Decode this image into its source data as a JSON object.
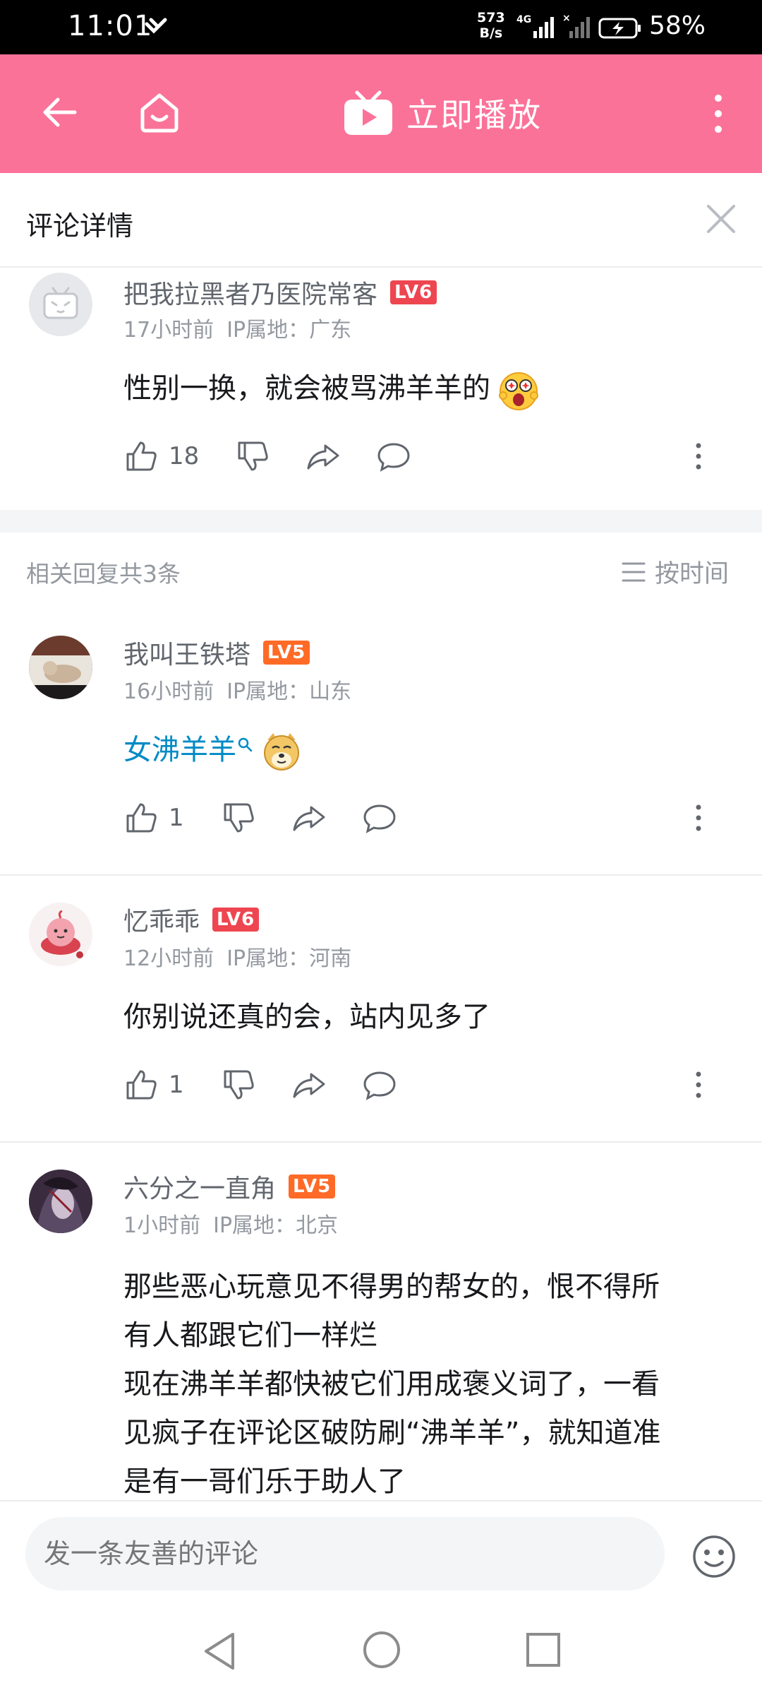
{
  "status_bar": {
    "time": "11:01",
    "net_speed_value": "573",
    "net_speed_unit": "B/s",
    "network": "4G",
    "battery": "58%"
  },
  "app_bar": {
    "play_label": "立即播放"
  },
  "sub_header": {
    "title": "评论详情"
  },
  "root_comment": {
    "username": "把我拉黑者乃医院常客",
    "level": "LV6",
    "time": "17小时前",
    "ip": "IP属地：广东",
    "text": "性别一换，就会被骂沸羊羊的",
    "emoji": "scared-face-emoji",
    "likes": "18"
  },
  "replies_header": {
    "count_text": "相关回复共3条",
    "sort_label": "按时间"
  },
  "replies": [
    {
      "username": "我叫王铁塔",
      "level": "LV5",
      "time": "16小时前",
      "ip": "IP属地：山东",
      "text": "女沸羊羊",
      "text_is_link": true,
      "emoji": "doge-emoji",
      "likes": "1"
    },
    {
      "username": "忆乖乖",
      "level": "LV6",
      "time": "12小时前",
      "ip": "IP属地：河南",
      "text": "你别说还真的会，站内见多了",
      "likes": "1"
    },
    {
      "username": "六分之一直角",
      "level": "LV5",
      "time": "1小时前",
      "ip": "IP属地：北京",
      "text_lines": [
        "那些恶心玩意见不得男的帮女的，恨不得所",
        "有人都跟它们一样烂",
        "现在沸羊羊都快被它们用成褒义词了，一看",
        "见疯子在评论区破防刷“沸羊羊”，就知道准",
        "是有一哥们乐于助人了"
      ]
    }
  ],
  "input": {
    "placeholder": "发一条友善的评论"
  },
  "colors": {
    "brand_pink": "#fb7299",
    "link_blue": "#008ac5",
    "lv6": "#ee4650",
    "lv5": "#ff6a27"
  }
}
